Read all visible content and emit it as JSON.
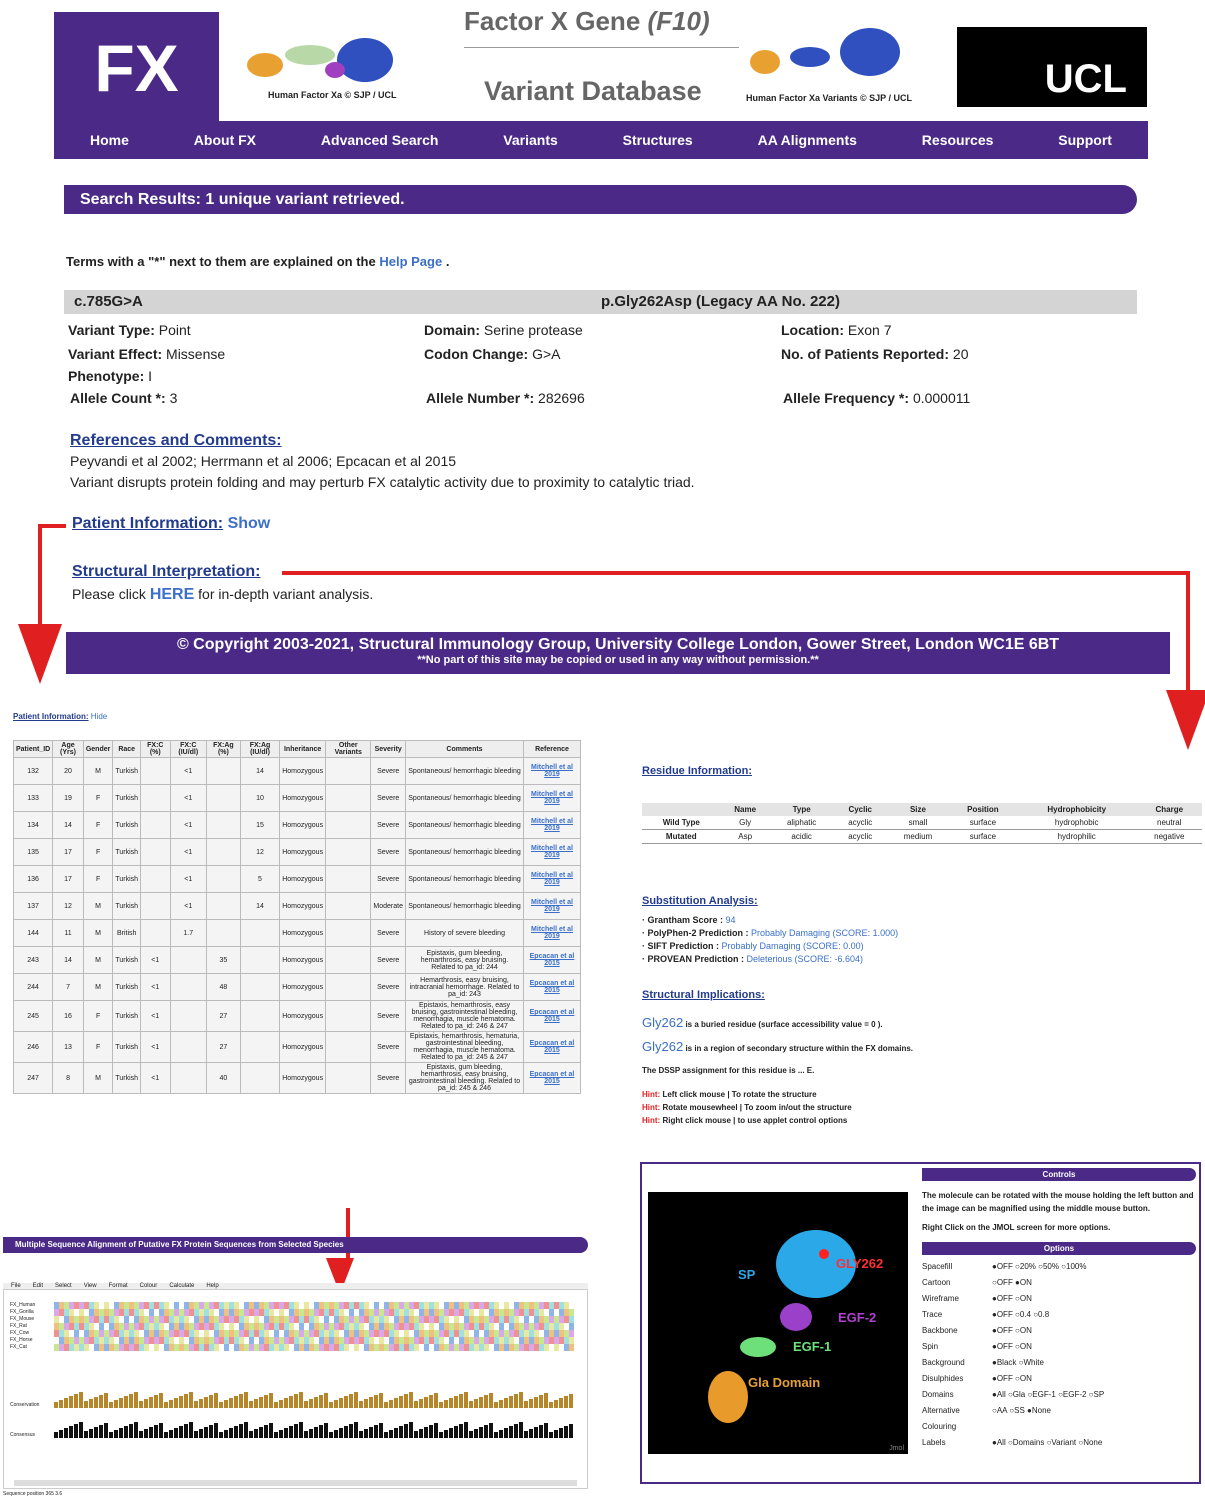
{
  "header": {
    "logo": "FX",
    "title": "Factor X Gene",
    "title_italic": "(F10)",
    "subtitle": "Variant Database",
    "caption_left": "Human Factor Xa © SJP / UCL",
    "caption_right": "Human Factor Xa Variants © SJP / UCL",
    "ucl": "UCL"
  },
  "nav": [
    "Home",
    "About FX",
    "Advanced Search",
    "Variants",
    "Structures",
    "AA Alignments",
    "Resources",
    "Support"
  ],
  "search_banner": "Search Results: 1 unique variant retrieved.",
  "help_note": {
    "pre": "Terms with a \"*\" next to them are explained on the",
    "link": "Help Page",
    "post": "."
  },
  "variant": {
    "cdna": "c.785G>A",
    "protein": "p.Gly262Asp (Legacy AA No. 222)",
    "type_l": "Variant Type:",
    "type_v": "Point",
    "domain_l": "Domain:",
    "domain_v": "Serine protease",
    "loc_l": "Location:",
    "loc_v": "Exon 7",
    "effect_l": "Variant Effect:",
    "effect_v": "Missense",
    "codon_l": "Codon Change:",
    "codon_v": "G>A",
    "patients_l": "No. of Patients Reported:",
    "patients_v": "20",
    "pheno_l": "Phenotype:",
    "pheno_v": "I",
    "allelecount_l": "Allele Count *:",
    "allelecount_v": "3",
    "allelenum_l": "Allele Number *:",
    "allelenum_v": "282696",
    "allelefreq_l": "Allele Frequency *:",
    "allelefreq_v": "0.000011"
  },
  "refs": {
    "title": "References and Comments:",
    "line1": "Peyvandi et al 2002; Herrmann et al 2006; Epcacan et al 2015",
    "line2": "Variant disrupts protein folding and may perturb FX catalytic activity due to proximity to catalytic triad."
  },
  "patient": {
    "title": "Patient Information:",
    "show": "Show",
    "hide": "Hide"
  },
  "structural": {
    "title": "Structural Interpretation:",
    "pre": "Please click",
    "link": "HERE",
    "post": "for in-depth variant analysis."
  },
  "footer": {
    "line1": "© Copyright 2003-2021, Structural Immunology Group, University College London, Gower Street, London WC1E 6BT",
    "line2": "**No part of this site may be copied or used in any way without permission.**"
  },
  "patient_table": {
    "headers": [
      "Patient_ID",
      "Age (Yrs)",
      "Gender",
      "Race",
      "FX:C (%)",
      "FX:C (IU/dl)",
      "FX:Ag (%)",
      "FX:Ag (IU/dl)",
      "Inheritance",
      "Other Variants",
      "Severity",
      "Comments",
      "Reference"
    ],
    "rows": [
      [
        "132",
        "20",
        "M",
        "Turkish",
        "",
        "<1",
        "",
        "14",
        "Homozygous",
        "",
        "Severe",
        "Spontaneous/ hemorrhagic bleeding",
        "Mitchell et al 2019"
      ],
      [
        "133",
        "19",
        "F",
        "Turkish",
        "",
        "<1",
        "",
        "10",
        "Homozygous",
        "",
        "Severe",
        "Spontaneous/ hemorrhagic bleeding",
        "Mitchell et al 2019"
      ],
      [
        "134",
        "14",
        "F",
        "Turkish",
        "",
        "<1",
        "",
        "15",
        "Homozygous",
        "",
        "Severe",
        "Spontaneous/ hemorrhagic bleeding",
        "Mitchell et al 2019"
      ],
      [
        "135",
        "17",
        "F",
        "Turkish",
        "",
        "<1",
        "",
        "12",
        "Homozygous",
        "",
        "Severe",
        "Spontaneous/ hemorrhagic bleeding",
        "Mitchell et al 2019"
      ],
      [
        "136",
        "17",
        "F",
        "Turkish",
        "",
        "<1",
        "",
        "5",
        "Homozygous",
        "",
        "Severe",
        "Spontaneous/ hemorrhagic bleeding",
        "Mitchell et al 2019"
      ],
      [
        "137",
        "12",
        "M",
        "Turkish",
        "",
        "<1",
        "",
        "14",
        "Homozygous",
        "",
        "Moderate",
        "Spontaneous/ hemorrhagic bleeding",
        "Mitchell et al 2019"
      ],
      [
        "144",
        "11",
        "M",
        "British",
        "",
        "1.7",
        "",
        "",
        "Homozygous",
        "",
        "Severe",
        "History of severe bleeding",
        "Mitchell et al 2019"
      ],
      [
        "243",
        "14",
        "M",
        "Turkish",
        "<1",
        "",
        "35",
        "",
        "Homozygous",
        "",
        "Severe",
        "Epistaxis, gum bleeding, hemarthrosis, easy bruising. Related to pa_id: 244",
        "Epcacan et al 2015"
      ],
      [
        "244",
        "7",
        "M",
        "Turkish",
        "<1",
        "",
        "48",
        "",
        "Homozygous",
        "",
        "Severe",
        "Hemarthrosis, easy bruising, intracranial hemorrhage. Related to pa_id: 243",
        "Epcacan et al 2015"
      ],
      [
        "245",
        "16",
        "F",
        "Turkish",
        "<1",
        "",
        "27",
        "",
        "Homozygous",
        "",
        "Severe",
        "Epistaxis, hemarthrosis, easy bruising, gastrointestinal bleeding, menorrhagia, muscle hematoma. Related to pa_id: 246 & 247",
        "Epcacan et al 2015"
      ],
      [
        "246",
        "13",
        "F",
        "Turkish",
        "<1",
        "",
        "27",
        "",
        "Homozygous",
        "",
        "Severe",
        "Epistaxis, hemarthrosis, hematuria, gastrointestinal bleeding, menorrhagia, muscle hematoma. Related to pa_id: 245 & 247",
        "Epcacan et al 2015"
      ],
      [
        "247",
        "8",
        "M",
        "Turkish",
        "<1",
        "",
        "40",
        "",
        "Homozygous",
        "",
        "Severe",
        "Epistaxis, gum bleeding, hemarthrosis, easy bruising, gastrointestinal bleeding. Related to pa_id: 245 & 246",
        "Epcacan et al 2015"
      ]
    ]
  },
  "alignment": {
    "title": "Multiple Sequence Alignment of Putative FX Protein Sequences from Selected Species",
    "menu": [
      "File",
      "Edit",
      "Select",
      "View",
      "Format",
      "Colour",
      "Calculate",
      "Help"
    ],
    "species": [
      "FX_Human",
      "FX_Gorilla",
      "FX_Mouse",
      "FX_Rat",
      "FX_Cow",
      "FX_Horse",
      "FX_Cat"
    ],
    "conservation": "Conservation",
    "consensus": "Consensus",
    "status": "Sequence position 365 3.6"
  },
  "residue": {
    "title": "Residue Information:",
    "headers": [
      "",
      "Name",
      "Type",
      "Cyclic",
      "Size",
      "Position",
      "Hydrophobicity",
      "Charge"
    ],
    "rows": [
      [
        "Wild Type",
        "Gly",
        "aliphatic",
        "acyclic",
        "small",
        "surface",
        "hydrophobic",
        "neutral"
      ],
      [
        "Mutated",
        "Asp",
        "acidic",
        "acyclic",
        "medium",
        "surface",
        "hydrophilic",
        "negative"
      ]
    ]
  },
  "substitution": {
    "title": "Substitution Analysis:",
    "items": [
      {
        "label": "Grantham Score :",
        "value": "94"
      },
      {
        "label": "PolyPhen-2 Prediction :",
        "value": "Probably Damaging (SCORE: 1.000)"
      },
      {
        "label": "SIFT Prediction :",
        "value": "Probably Damaging (SCORE: 0.00)"
      },
      {
        "label": "PROVEAN Prediction :",
        "value": "Deleterious (SCORE: -6.604)"
      }
    ]
  },
  "implications": {
    "title": "Structural Implications:",
    "res": "Gly262",
    "line1": "is a buried residue (surface accessibility value = 0 ).",
    "line2": "is in a region of secondary structure within the FX domains.",
    "dssp": "The DSSP assignment for this residue is ... E.",
    "hints": [
      {
        "h": "Hint:",
        "t": "Left click mouse | To rotate the structure"
      },
      {
        "h": "Hint:",
        "t": "Rotate mousewheel | To zoom in/out the structure"
      },
      {
        "h": "Hint:",
        "t": "Right click mouse | to use applet control options"
      }
    ]
  },
  "jmol": {
    "labels": [
      "SP",
      "GLY262",
      "EGF-2",
      "EGF-1",
      "Gla Domain"
    ],
    "brand": "Jmol"
  },
  "controls": {
    "title": "Controls",
    "desc": "The molecule can be rotated with the mouse holding the left button and the image can be magnified using the middle mouse button.",
    "right_click": "Right Click on the JMOL screen for more options.",
    "options_title": "Options",
    "options": [
      [
        "Spacefill",
        "●OFF ○20% ○50% ○100%"
      ],
      [
        "Cartoon",
        "○OFF ●ON"
      ],
      [
        "Wireframe",
        "●OFF ○ON"
      ],
      [
        "Trace",
        "●OFF ○0.4 ○0.8"
      ],
      [
        "Backbone",
        "●OFF ○ON"
      ],
      [
        "Spin",
        "●OFF ○ON"
      ],
      [
        "Background",
        "●Black ○White"
      ],
      [
        "Disulphides",
        "●OFF ○ON"
      ],
      [
        "Domains",
        "●All ○Gla ○EGF-1 ○EGF-2 ○SP"
      ],
      [
        "Alternative Colouring",
        "○AA ○SS ●None"
      ],
      [
        "Labels",
        "●All ○Domains ○Variant ○None"
      ]
    ]
  }
}
